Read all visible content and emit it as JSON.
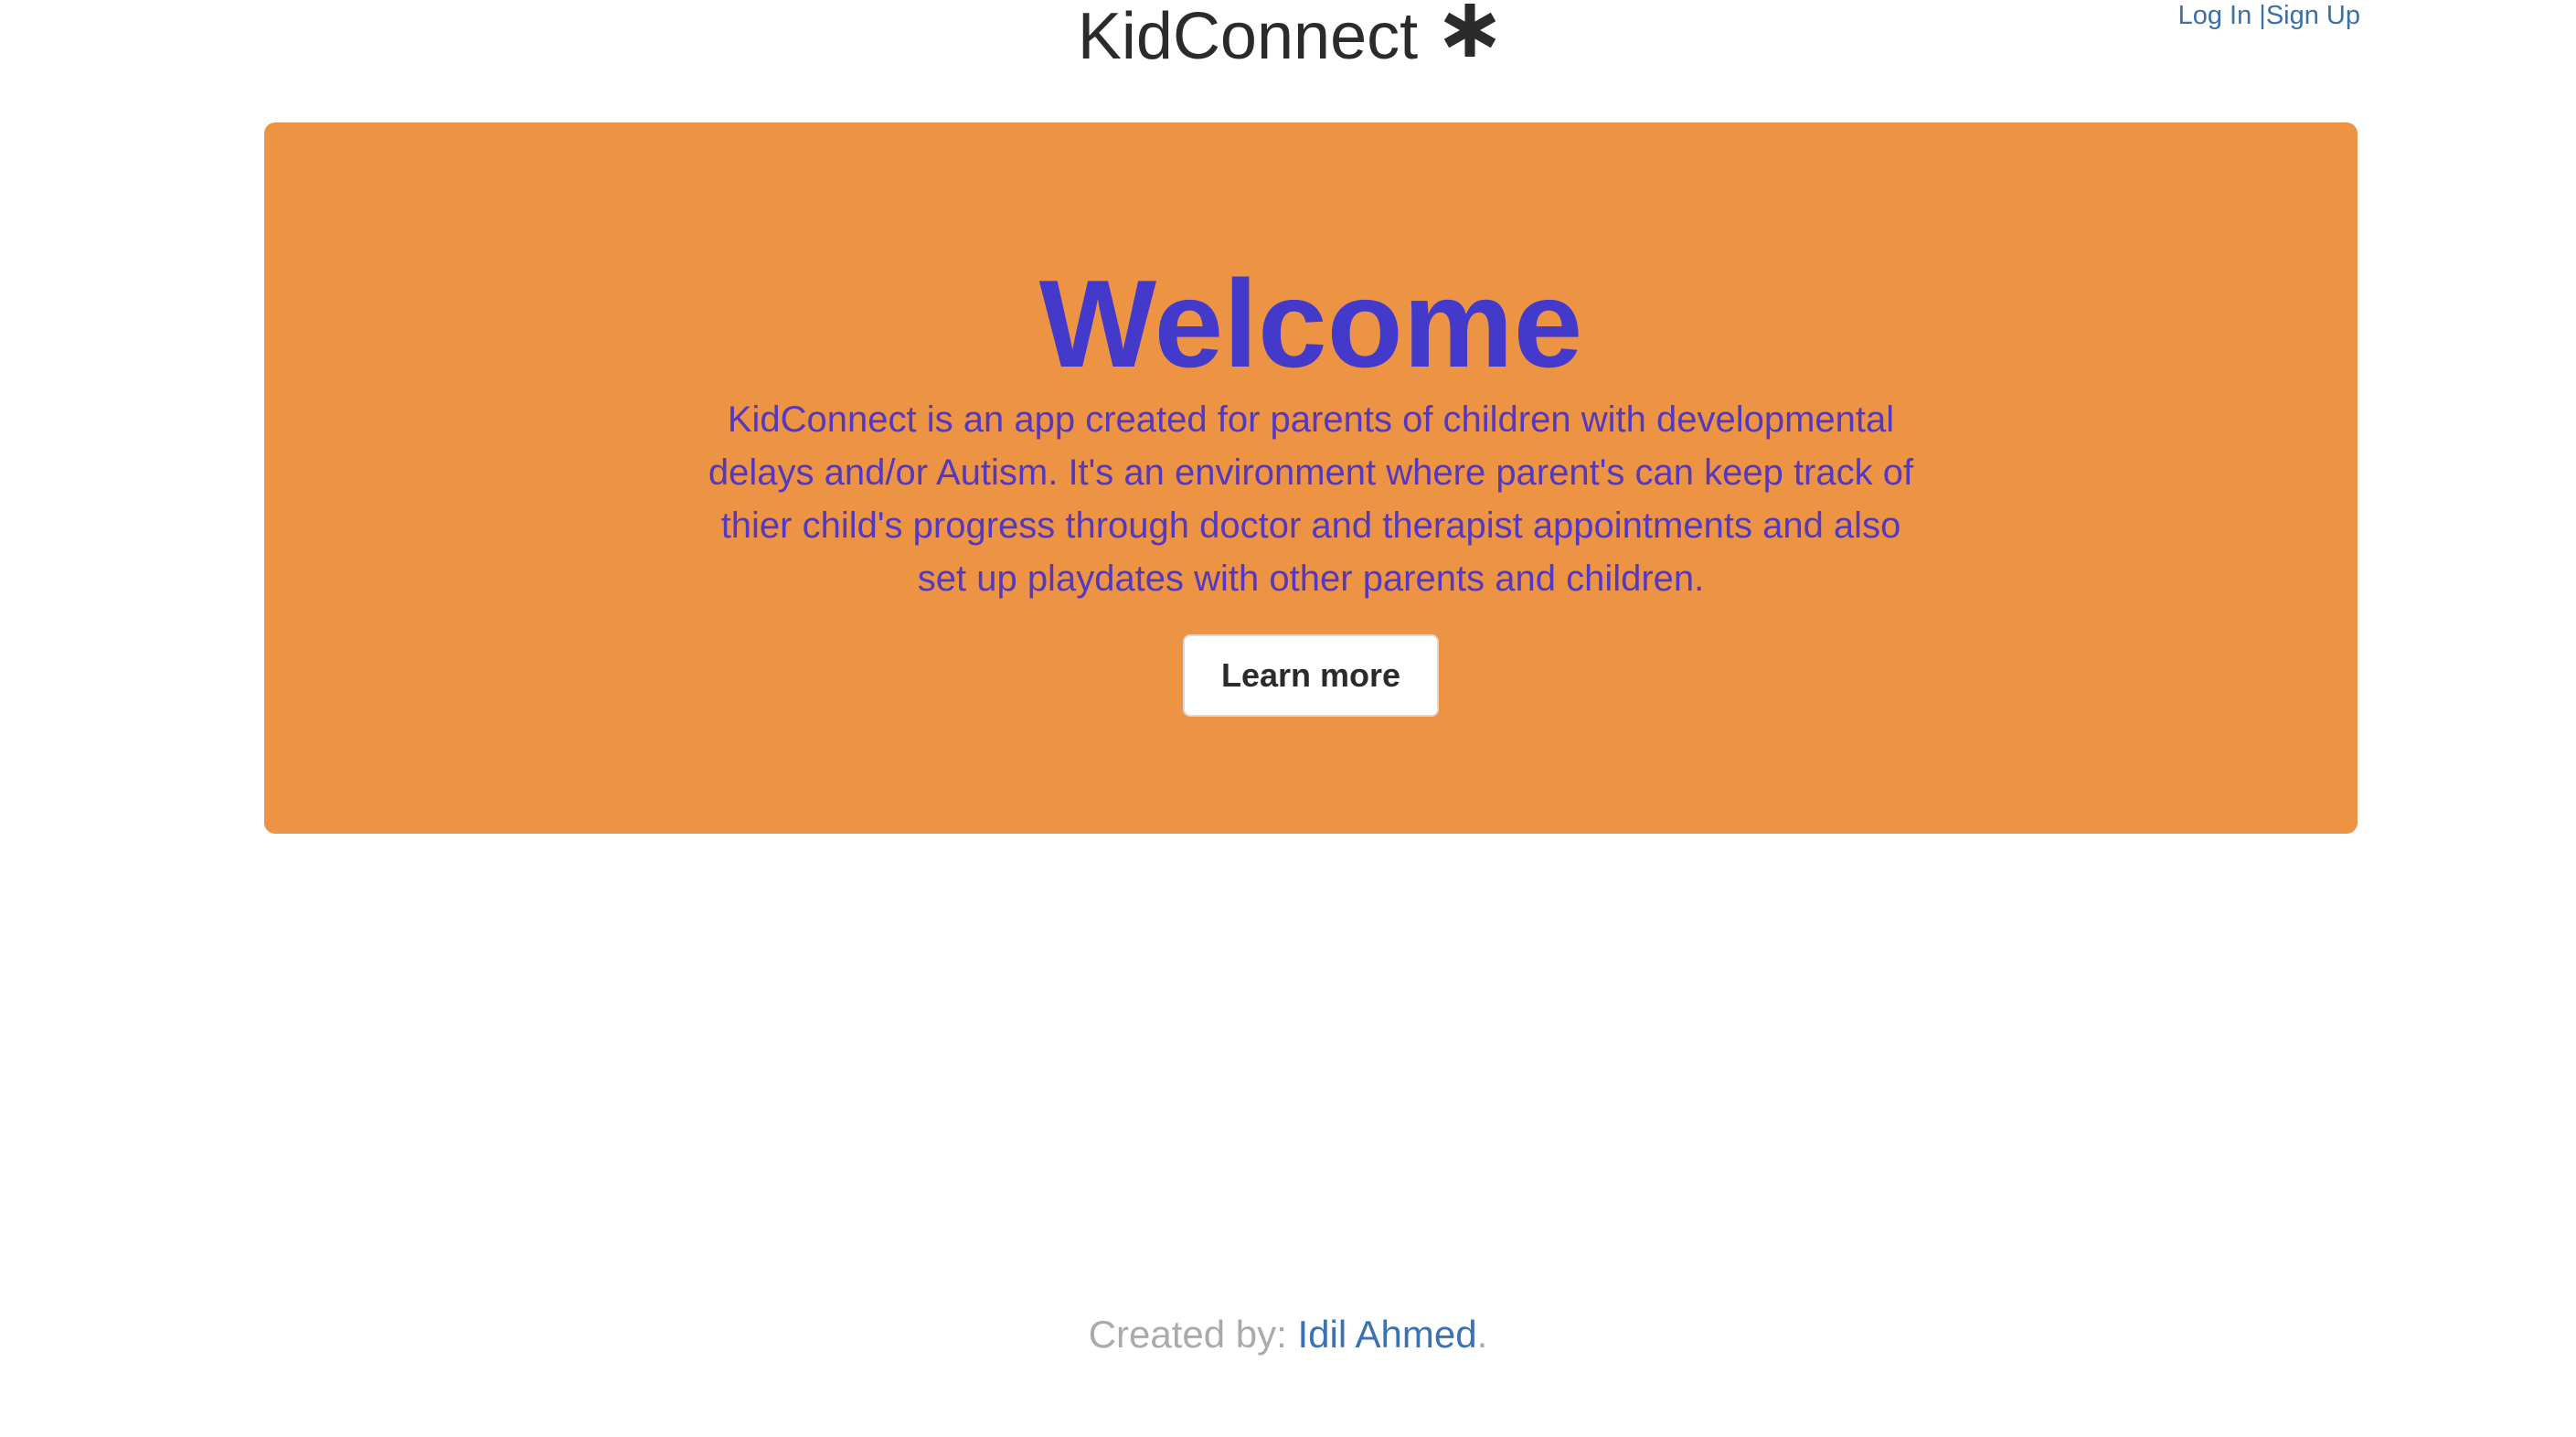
{
  "header": {
    "brand_name": "KidConnect",
    "brand_icon": "asterisk-icon",
    "login_label": "Log In",
    "separator": "|",
    "signup_label": "Sign Up"
  },
  "hero": {
    "title": "Welcome",
    "description": "KidConnect is an app created for parents of children with developmental delays and/or Autism. It's an environment where parent's can keep track of thier child's progress through doctor and therapist appointments and also set up playdates with other parents and children.",
    "button_label": "Learn more"
  },
  "footer": {
    "prefix": "Created by: ",
    "author": "Idil Ahmed",
    "suffix": "."
  },
  "colors": {
    "hero_background": "#ec9444",
    "hero_title": "#433acb",
    "hero_text": "#5538c0",
    "link": "#3a6fa8",
    "brand_text": "#2b2b2b"
  }
}
